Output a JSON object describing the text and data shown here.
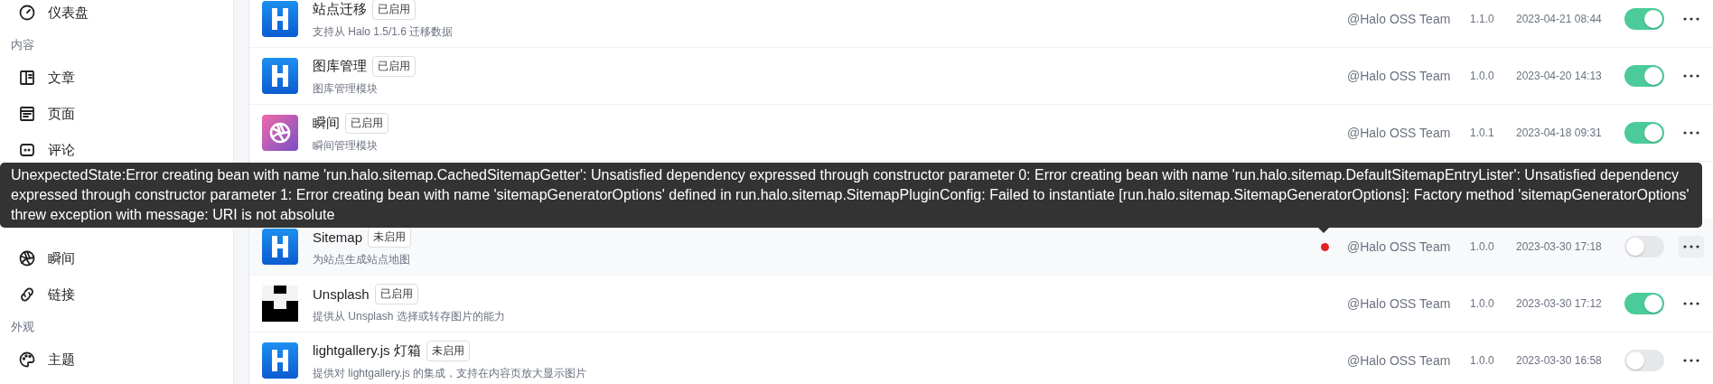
{
  "sidebar": {
    "items": [
      {
        "kind": "link",
        "label": "仪表盘"
      },
      {
        "kind": "header",
        "label": "内容"
      },
      {
        "kind": "link",
        "label": "文章"
      },
      {
        "kind": "link",
        "label": "页面"
      },
      {
        "kind": "link",
        "label": "评论"
      },
      {
        "kind": "link",
        "label": "瞬间"
      },
      {
        "kind": "link",
        "label": "链接"
      },
      {
        "kind": "header",
        "label": "外观"
      },
      {
        "kind": "link",
        "label": "主题"
      }
    ]
  },
  "plugins": [
    {
      "kind": "halo",
      "name": "站点迁移",
      "badge": "已启用",
      "description": "支持从 Halo 1.5/1.6 迁移数据",
      "author": "@Halo OSS Team",
      "version": "1.1.0",
      "date": "2023-04-21 08:44",
      "enabled": true,
      "hovered": false,
      "error": false
    },
    {
      "kind": "halo",
      "name": "图库管理",
      "badge": "已启用",
      "description": "图库管理模块",
      "author": "@Halo OSS Team",
      "version": "1.0.0",
      "date": "2023-04-20 14:13",
      "enabled": true,
      "hovered": false,
      "error": false
    },
    {
      "kind": "moments",
      "name": "瞬间",
      "badge": "已启用",
      "description": "瞬间管理模块",
      "author": "@Halo OSS Team",
      "version": "1.0.1",
      "date": "2023-04-18 09:31",
      "enabled": true,
      "hovered": false,
      "error": false
    },
    {
      "kind": "halo",
      "name": "Sitemap",
      "badge": "未启用",
      "description": "为站点生成站点地图",
      "author": "@Halo OSS Team",
      "version": "1.0.0",
      "date": "2023-03-30 17:18",
      "enabled": false,
      "hovered": true,
      "error": true
    },
    {
      "kind": "unsplash",
      "name": "Unsplash",
      "badge": "已启用",
      "description": "提供从 Unsplash 选择或转存图片的能力",
      "author": "@Halo OSS Team",
      "version": "1.0.0",
      "date": "2023-03-30 17:12",
      "enabled": true,
      "hovered": false,
      "error": false
    },
    {
      "kind": "halo",
      "name": "lightgallery.js 灯箱",
      "badge": "未启用",
      "description": "提供对 lightgallery.js 的集成，支持在内容页放大显示图片",
      "author": "@Halo OSS Team",
      "version": "1.0.0",
      "date": "2023-03-30 16:58",
      "enabled": false,
      "hovered": false,
      "error": false
    }
  ],
  "tooltip": {
    "text": "UnexpectedState:Error creating bean with name 'run.halo.sitemap.CachedSitemapGetter': Unsatisfied dependency expressed through constructor parameter 0: Error creating bean with name 'run.halo.sitemap.DefaultSitemapEntryLister': Unsatisfied dependency expressed through constructor parameter 1: Error creating bean with name 'sitemapGeneratorOptions' defined in run.halo.sitemap.SitemapPluginConfig: Failed to instantiate [run.halo.sitemap.SitemapGeneratorOptions]: Factory method 'sitemapGeneratorOptions' threw exception with message: URI is not absolute"
  }
}
